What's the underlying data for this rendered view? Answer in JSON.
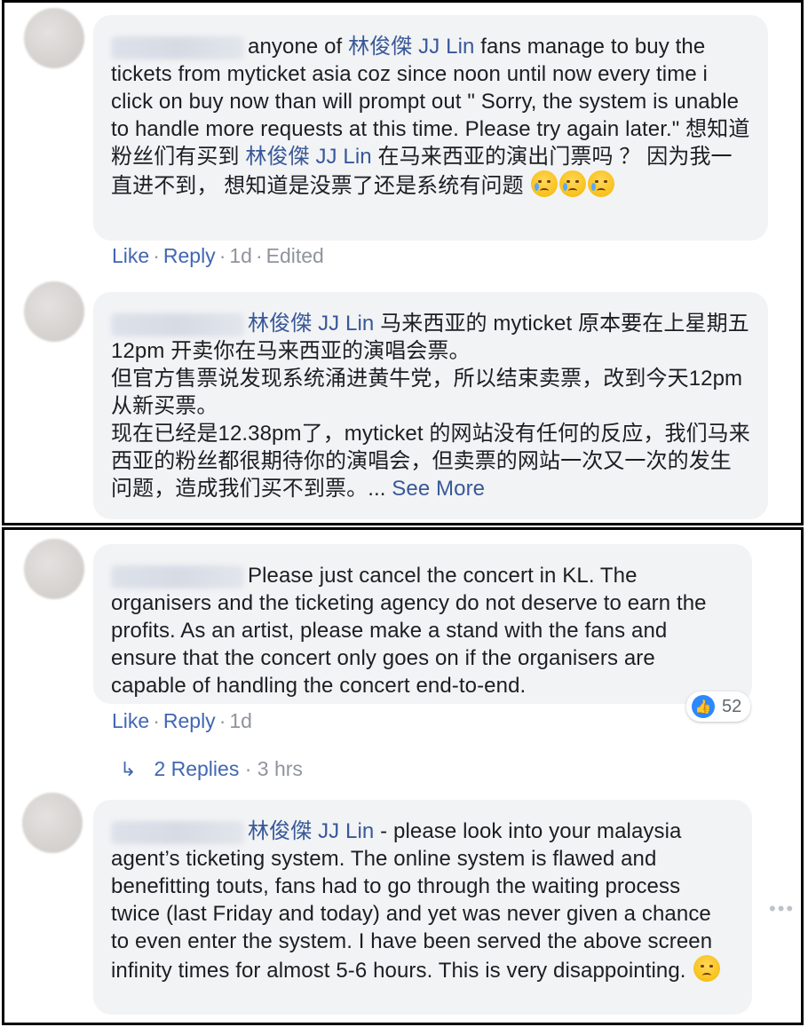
{
  "comments": [
    {
      "text_before_mention": "anyone of ",
      "mention": "林俊傑 JJ Lin",
      "text_after_mention": " fans manage to buy the tickets from myticket asia coz since noon until now every time i click on buy now than will prompt out \"\nSorry, the system is unable to handle more requests at this time. Please try again later.\" 想知道粉丝们有买到 ",
      "mention2": "林俊傑 JJ Lin",
      "text_end": " 在马来西亚的演出门票吗 ？ 因为我一直进不到， 想知道是没票了还是系统有问题 ",
      "emoji_names": [
        "crying-face-icon",
        "crying-face-icon",
        "crying-face-icon"
      ],
      "like_label": "Like",
      "reply_label": "Reply",
      "age": "1d",
      "edited": "Edited"
    },
    {
      "mention": "林俊傑 JJ Lin",
      "text_line1": " 马来西亚的 myticket 原本要在上星期五 12pm 开卖你在马来西亚的演唱会票。",
      "text_line2": "但官方售票说发现系统涌进黄牛党，所以结束卖票，改到今天12pm 从新买票。",
      "text_line3": "现在已经是12.38pm了，myticket 的网站没有任何的反应，我们马来西亚的粉丝都很期待你的演唱会，但卖票的网站一次又一次的发生问题，造成我们买不到票。... ",
      "see_more": "See More"
    },
    {
      "text": "Please just cancel the concert in KL. The organisers and the ticketing agency do not deserve to earn the profits. As an artist, please make a stand with the fans and ensure that the concert only goes on if the organisers are capable of handling the concert end-to-end.",
      "like_label": "Like",
      "reply_label": "Reply",
      "age": "1d",
      "reaction_count": "52",
      "replies_label": "2 Replies",
      "replies_age": "3 hrs"
    },
    {
      "mention": "林俊傑 JJ Lin",
      "text": " - please look into your malaysia agent’s ticketing system. The online system is flawed and benefitting touts, fans had to go through the waiting process twice (last Friday and today) and yet was never given a chance to even enter the system. I have been served the above screen infinity times for almost 5-6 hours. This is very disappointing. ",
      "emoji_name": "pensive-face-icon",
      "more_options": "•••"
    }
  ],
  "colors": {
    "link": "#385898",
    "meta_link": "#4267b2",
    "bubble_bg": "#f2f3f5",
    "like_badge": "#2d88ff"
  }
}
